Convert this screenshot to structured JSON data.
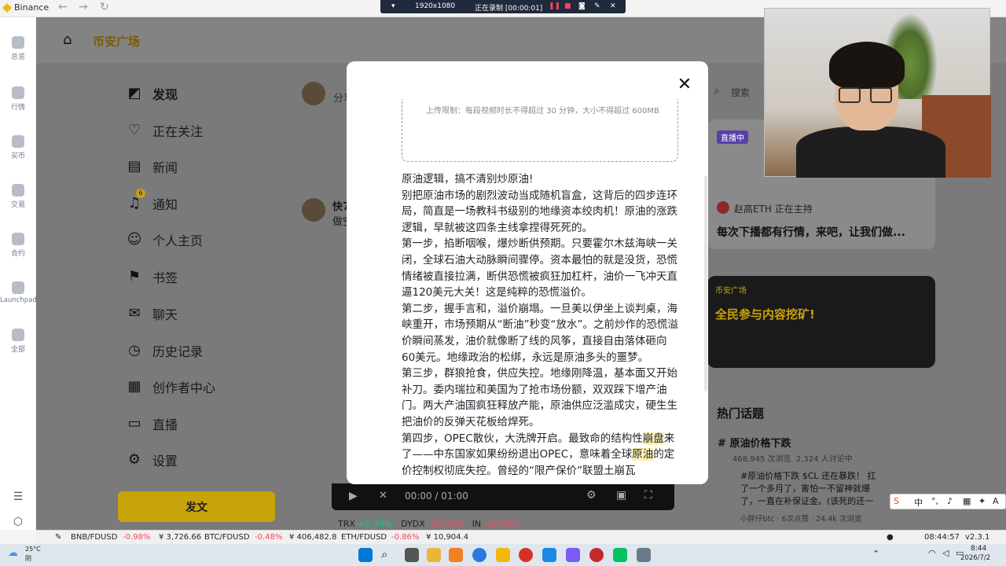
{
  "browser": {
    "app_title": "Binance"
  },
  "recording_bar": {
    "resolution": "1920x1080",
    "status": "正在录制 [00:00:01]"
  },
  "rail": [
    {
      "label": "总览"
    },
    {
      "label": "行情"
    },
    {
      "label": "买币"
    },
    {
      "label": "交易"
    },
    {
      "label": "合约"
    },
    {
      "label": "Launchpad"
    },
    {
      "label": "全部"
    }
  ],
  "header": {
    "brand": "币安广场"
  },
  "nav": [
    {
      "label": "发现",
      "icon": "discover-icon"
    },
    {
      "label": "正在关注",
      "icon": "following-icon"
    },
    {
      "label": "新闻",
      "icon": "news-icon"
    },
    {
      "label": "通知",
      "icon": "bell-icon",
      "badge": "6"
    },
    {
      "label": "个人主页",
      "icon": "profile-icon"
    },
    {
      "label": "书签",
      "icon": "bookmark-icon"
    },
    {
      "label": "聊天",
      "icon": "chat-icon"
    },
    {
      "label": "历史记录",
      "icon": "history-icon"
    },
    {
      "label": "创作者中心",
      "icon": "creator-icon"
    },
    {
      "label": "直播",
      "icon": "live-icon"
    },
    {
      "label": "设置",
      "icon": "settings-icon"
    }
  ],
  "post_button": "发文",
  "feed": {
    "share_placeholder": "分享",
    "post_author": "快7",
    "post_snippet": "做空",
    "video_time": "00:00 / 01:00"
  },
  "right": {
    "search_placeholder": "搜索",
    "live_badge": "直播中",
    "host_line": "赵高ETH 正在主持",
    "live_title": "每次下播都有行情，来吧，让我们做...",
    "banner_brand": "币安广场",
    "banner_text": "全民参与内容挖矿!",
    "hot_title": "热门话题",
    "topic_name": "原油价格下跌",
    "topic_views": "468,945 次浏览",
    "topic_discuss": "2,324 人讨论中",
    "topic_post": "#原油价格下跌 $CL 还在暴跌！ 扛了一个多月了，害怕一不留神就爆了，一直在补保证金。(该死的还一直在收资金费) 不知",
    "topic_meta": "小胖仔btc · 6次点赞 · 24.4k 次浏览"
  },
  "modal": {
    "upload_limit": "上传限制：每段视频时长不得超过 30 分钟，大小不得超过 600MB",
    "paragraphs": [
      "原油逻辑，搞不清别炒原油!",
      "别把原油市场的剧烈波动当成随机盲盒，这背后的四步连环局，简直是一场教科书级别的地缘资本绞肉机！原油的涨跌逻辑，早就被这四条主线拿捏得死死的。",
      "第一步，掐断咽喉，爆炒断供预期。只要霍尔木兹海峡一关闭，全球石油大动脉瞬间骤停。资本最怕的就是没货，恐慌情绪被直接拉满，断供恐慌被疯狂加杠杆，油价一飞冲天直逼120美元大关！这是纯粹的恐慌溢价。",
      "第二步，握手言和，溢价崩塌。一旦美以伊坐上谈判桌，海峡重开，市场预期从“断油”秒变“放水”。之前炒作的恐慌溢价瞬间蒸发，油价就像断了线的风筝，直接自由落体砸向60美元。地缘政治的松绑，永远是原油多头的噩梦。",
      "第三步，群狼抢食，供应失控。地缘刚降温，基本面又开始补刀。委内瑞拉和美国为了抢市场份额，双双踩下增产油门。两大产油国疯狂释放产能，原油供应泛滥成灾，硬生生把油价的反弹天花板给焊死。"
    ],
    "p4_start": "第四步，OPEC散伙，大洗牌开启。最致命的结构性",
    "p4_hl1": "崩盘",
    "p4_mid": "来了——中东国家如果纷纷退出OPEC，意味着全球",
    "p4_hl2": "原油",
    "p4_end": "的定价控制权彻底失控。曾经的“限产保价”联盟土崩瓦"
  },
  "ticker": [
    {
      "pair": "BNB/FDUSD",
      "change": "-0.98%",
      "price": "¥ 3,726.66"
    },
    {
      "pair": "BTC/FDUSD",
      "change": "-0.48%",
      "price": "¥ 406,482.8"
    },
    {
      "pair": "ETH/FDUSD",
      "change": "-0.86%",
      "price": "¥ 10,904.4"
    }
  ],
  "ticker_right": {
    "time": "08:44:57",
    "version": "v2.3.1"
  },
  "behind_modal_row": {
    "trx": "TRX",
    "trx_change": "+0.34%",
    "dydx": "DYDX",
    "dydx_change": "-25.96%",
    "in": "IN",
    "in_change": "-12.59%"
  },
  "taskbar": {
    "weather_temp": "25°C",
    "weather_desc": "阴",
    "clock_time": "8:44",
    "clock_date": "2026/7/2",
    "ime": "中"
  },
  "colors": {
    "brand": "#f0b90b",
    "negative": "#f6465d",
    "positive": "#0ecb81"
  }
}
